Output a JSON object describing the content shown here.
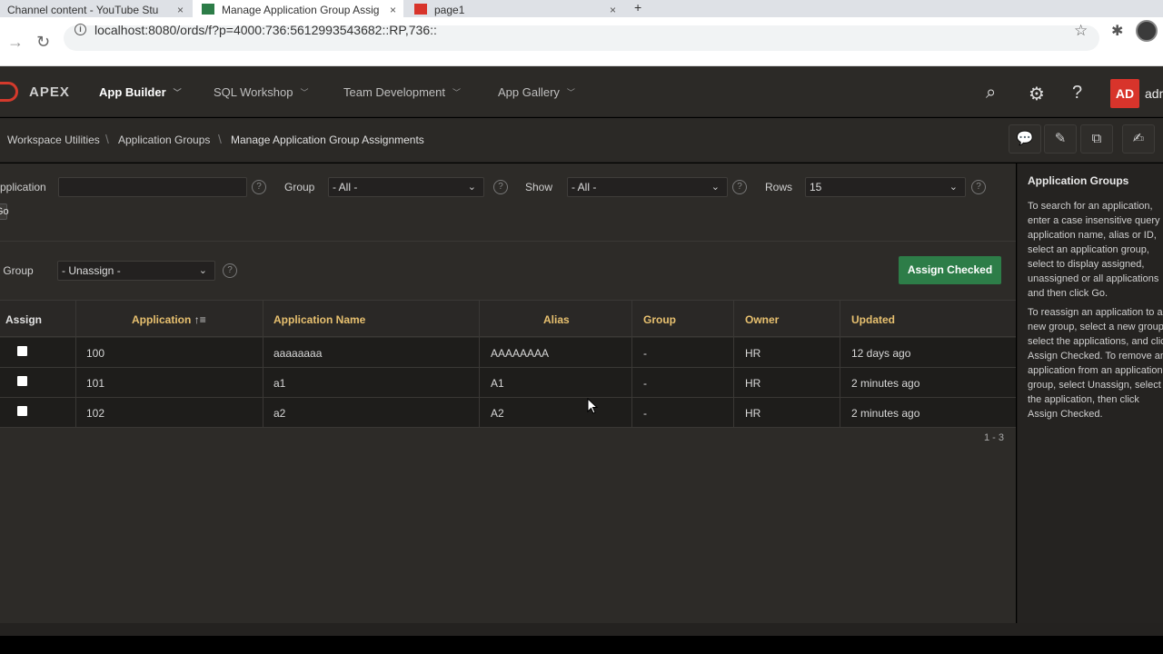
{
  "browser": {
    "tabs": [
      {
        "title": "Channel content - YouTube Stu",
        "close": "×"
      },
      {
        "title": "Manage Application Group Assig",
        "close": "×"
      },
      {
        "title": "page1",
        "close": "×"
      }
    ],
    "new_tab": "+",
    "url": "localhost:8080/ords/f?p=4000:736:5612993543682::RP,736::"
  },
  "header": {
    "logo": "APEX",
    "menus": [
      {
        "label": "App Builder"
      },
      {
        "label": "SQL Workshop"
      },
      {
        "label": "Team Development"
      },
      {
        "label": "App Gallery"
      }
    ],
    "avatar": "AD",
    "user": "admin"
  },
  "breadcrumb": [
    "Workspace Utilities",
    "Application Groups",
    "Manage Application Group Assignments"
  ],
  "filters": {
    "application_label": "Application",
    "application_value": "",
    "group_label": "Group",
    "group_value": "- All -",
    "show_label": "Show",
    "show_value": "- All -",
    "rows_label": "Rows",
    "rows_value": "15",
    "go_label": "Go",
    "new_group_label": "New Group",
    "new_group_value": "- Unassign -",
    "assign_button": "Assign Checked"
  },
  "table": {
    "columns": [
      "Assign",
      "Application",
      "Application Name",
      "Alias",
      "Group",
      "Owner",
      "Updated"
    ],
    "rows": [
      {
        "application": "100",
        "name": "aaaaaaaa",
        "alias": "AAAAAAAA",
        "group": "-",
        "owner": "HR",
        "updated": "12 days ago",
        "checked": false
      },
      {
        "application": "101",
        "name": "a1",
        "alias": "A1",
        "group": "-",
        "owner": "HR",
        "updated": "2 minutes ago",
        "checked": false
      },
      {
        "application": "102",
        "name": "a2",
        "alias": "A2",
        "group": "-",
        "owner": "HR",
        "updated": "2 minutes ago",
        "checked": false
      }
    ],
    "pagination": "1 - 3"
  },
  "sidebar": {
    "title": "Application Groups",
    "para1": "To search for an application,\nenter a case insensitive query\napplication name, alias or ID,\nselect an application group,\nselect to display assigned,\nunassigned or all applications\nand then click Go.",
    "para2": "To reassign an application to a\nnew group, select a new group,\nselect the applications, and click\nAssign Checked. To remove an\napplication from an application\ngroup, select Unassign, select\nthe application, then click\nAssign Checked."
  },
  "colors": {
    "accent_red": "#d8342b",
    "assign_green": "#2d7d48",
    "header_gold": "#e7c06f"
  }
}
